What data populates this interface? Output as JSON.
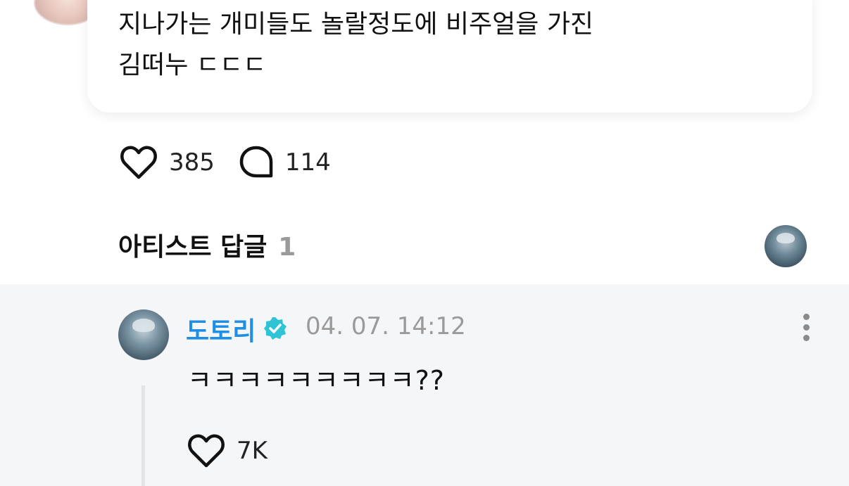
{
  "post": {
    "text": "지나가는 개미들도 놀랄정도에 비주얼을 가진\n김떠누 ㄷㄷㄷ",
    "like_count": "385",
    "comment_count": "114",
    "like_icon": "heart-outline-icon",
    "comment_icon": "speech-bubble-icon"
  },
  "artist_replies": {
    "title": "아티스트 답글",
    "count": "1"
  },
  "reply": {
    "author": "도토리",
    "verified_icon": "verified-badge-icon",
    "verified_color": "#2ec4d6",
    "author_color": "#1f8fe5",
    "date": "04. 07. 14:12",
    "text": "ㅋㅋㅋㅋㅋㅋㅋㅋㅋ??",
    "like_count": "7K",
    "more_icon": "more-vertical-icon"
  },
  "colors": {
    "reply_background": "#f5f6f8",
    "muted_text": "#9a9a9a"
  }
}
